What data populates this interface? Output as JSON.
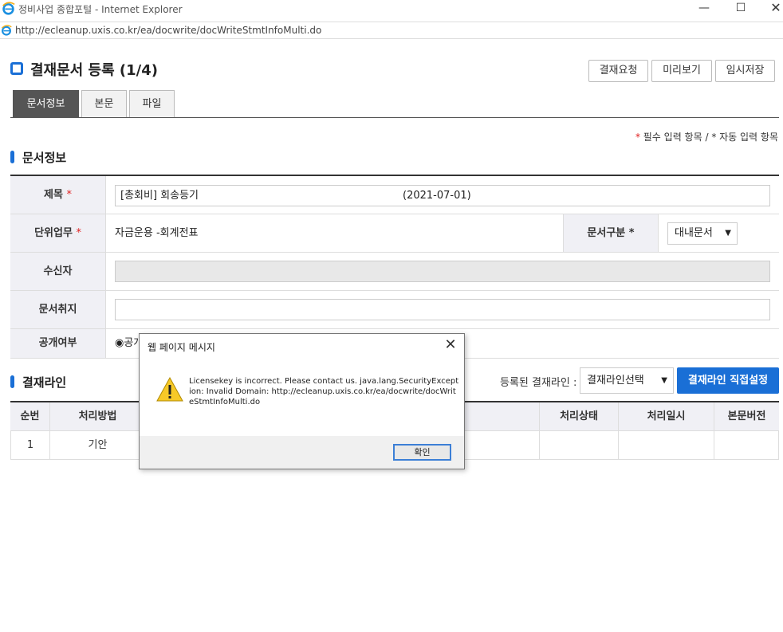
{
  "window": {
    "title": "정비사업 종합포털 - Internet Explorer",
    "url": "http://ecleanup.uxis.co.kr/ea/docwrite/docWriteStmtInfoMulti.do"
  },
  "page": {
    "title": "결재문서 등록 (1/4)"
  },
  "toolbar": {
    "request": "결재요청",
    "preview": "미리보기",
    "save_temp": "임시저장"
  },
  "tabs": [
    "문서정보",
    "본문",
    "파일"
  ],
  "required_note": {
    "star1": "*",
    "text1": " 필수 입력 항목 / ",
    "star2": "*",
    "text2": " 자동 입력 항목"
  },
  "doc_section": {
    "title": "문서정보"
  },
  "form": {
    "subject_label": "제목",
    "subject_value": "[총회비] 회송등기",
    "subject_date": "(2021-07-01)",
    "unit_label": "단위업무",
    "unit_value": "자금운용 -회계전표",
    "doctype_label": "문서구분",
    "doctype_value": "대내문서",
    "recipient_label": "수신자",
    "purpose_label": "문서취지",
    "public_label": "공개여부",
    "public_option": "◉공개",
    "star": "*"
  },
  "approval_section": {
    "title": "결재라인",
    "registered_label": "등록된 결재라인 :",
    "select_value": "결재라인선택",
    "direct_button": "결재라인 직접설정"
  },
  "approval_table": {
    "headers": [
      "순번",
      "처리방법",
      "처리상태",
      "처리일시",
      "본문버전"
    ],
    "row": {
      "no": "1",
      "method": "기안"
    }
  },
  "dialog": {
    "title": "웹 페이지 메시지",
    "message": "Licensekey is incorrect. Please contact us. java.lang.SecurityException: Invalid Domain: http://ecleanup.uxis.co.kr/ea/docwrite/docWriteStmtInfoMulti.do",
    "ok": "확인"
  },
  "colors": {
    "accent": "#1a6fd6",
    "required": "#e02020"
  }
}
